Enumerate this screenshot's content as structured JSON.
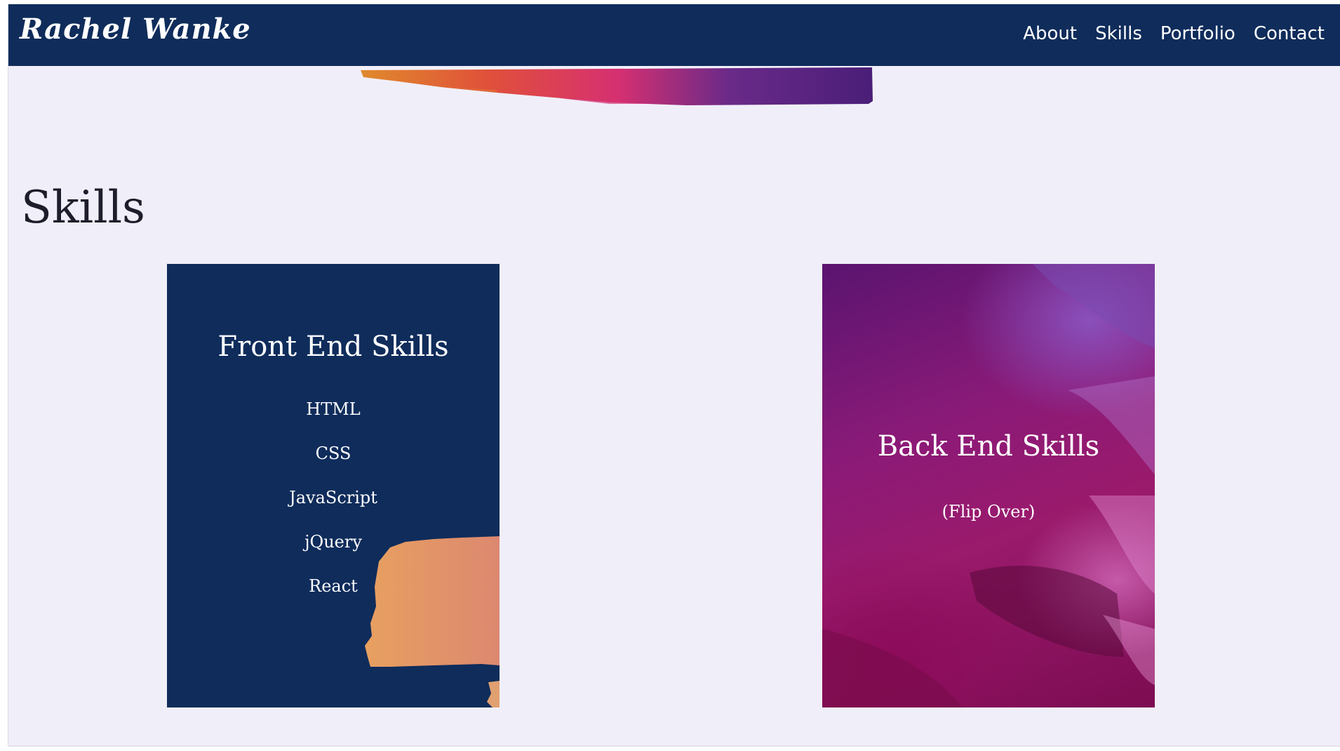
{
  "colors": {
    "nav_bg": "#0f2c5b",
    "page_bg": "#f0eff9",
    "card_front_bg": "#0f2c5b",
    "card_back_bg": "#8a1a78",
    "text_light": "#ffffff",
    "text_dark": "#1d1d2b"
  },
  "nav": {
    "brand": "Rachel Wanke",
    "links": [
      {
        "label": "About"
      },
      {
        "label": "Skills"
      },
      {
        "label": "Portfolio"
      },
      {
        "label": "Contact"
      }
    ]
  },
  "skills_section": {
    "title": "Skills",
    "front_card": {
      "heading": "Front End Skills",
      "items": [
        "HTML",
        "CSS",
        "JavaScript",
        "jQuery",
        "React"
      ]
    },
    "back_card": {
      "heading": "Back End Skills",
      "note": "(Flip Over)"
    }
  }
}
